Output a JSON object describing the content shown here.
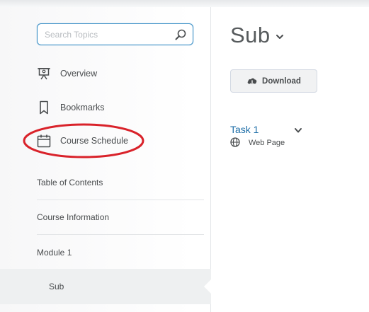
{
  "search": {
    "placeholder": "Search Topics",
    "icon": "search-icon"
  },
  "sidebar": {
    "items": [
      {
        "label": "Overview",
        "icon": "presentation-icon"
      },
      {
        "label": "Bookmarks",
        "icon": "bookmark-icon"
      },
      {
        "label": "Course Schedule",
        "icon": "calendar-icon"
      }
    ],
    "toc": [
      {
        "label": "Table of Contents"
      },
      {
        "label": "Course Information"
      },
      {
        "label": "Module 1"
      }
    ],
    "selected": {
      "label": "Sub"
    }
  },
  "annotation": {
    "color": "#d9222a",
    "shape": "ellipse"
  },
  "main": {
    "title": "Sub",
    "download_label": "Download",
    "task": {
      "title": "Task 1",
      "type": "Web Page",
      "icon": "globe-icon"
    }
  },
  "colors": {
    "accent": "#1f6fa8",
    "search_border": "#3a8fc6"
  }
}
